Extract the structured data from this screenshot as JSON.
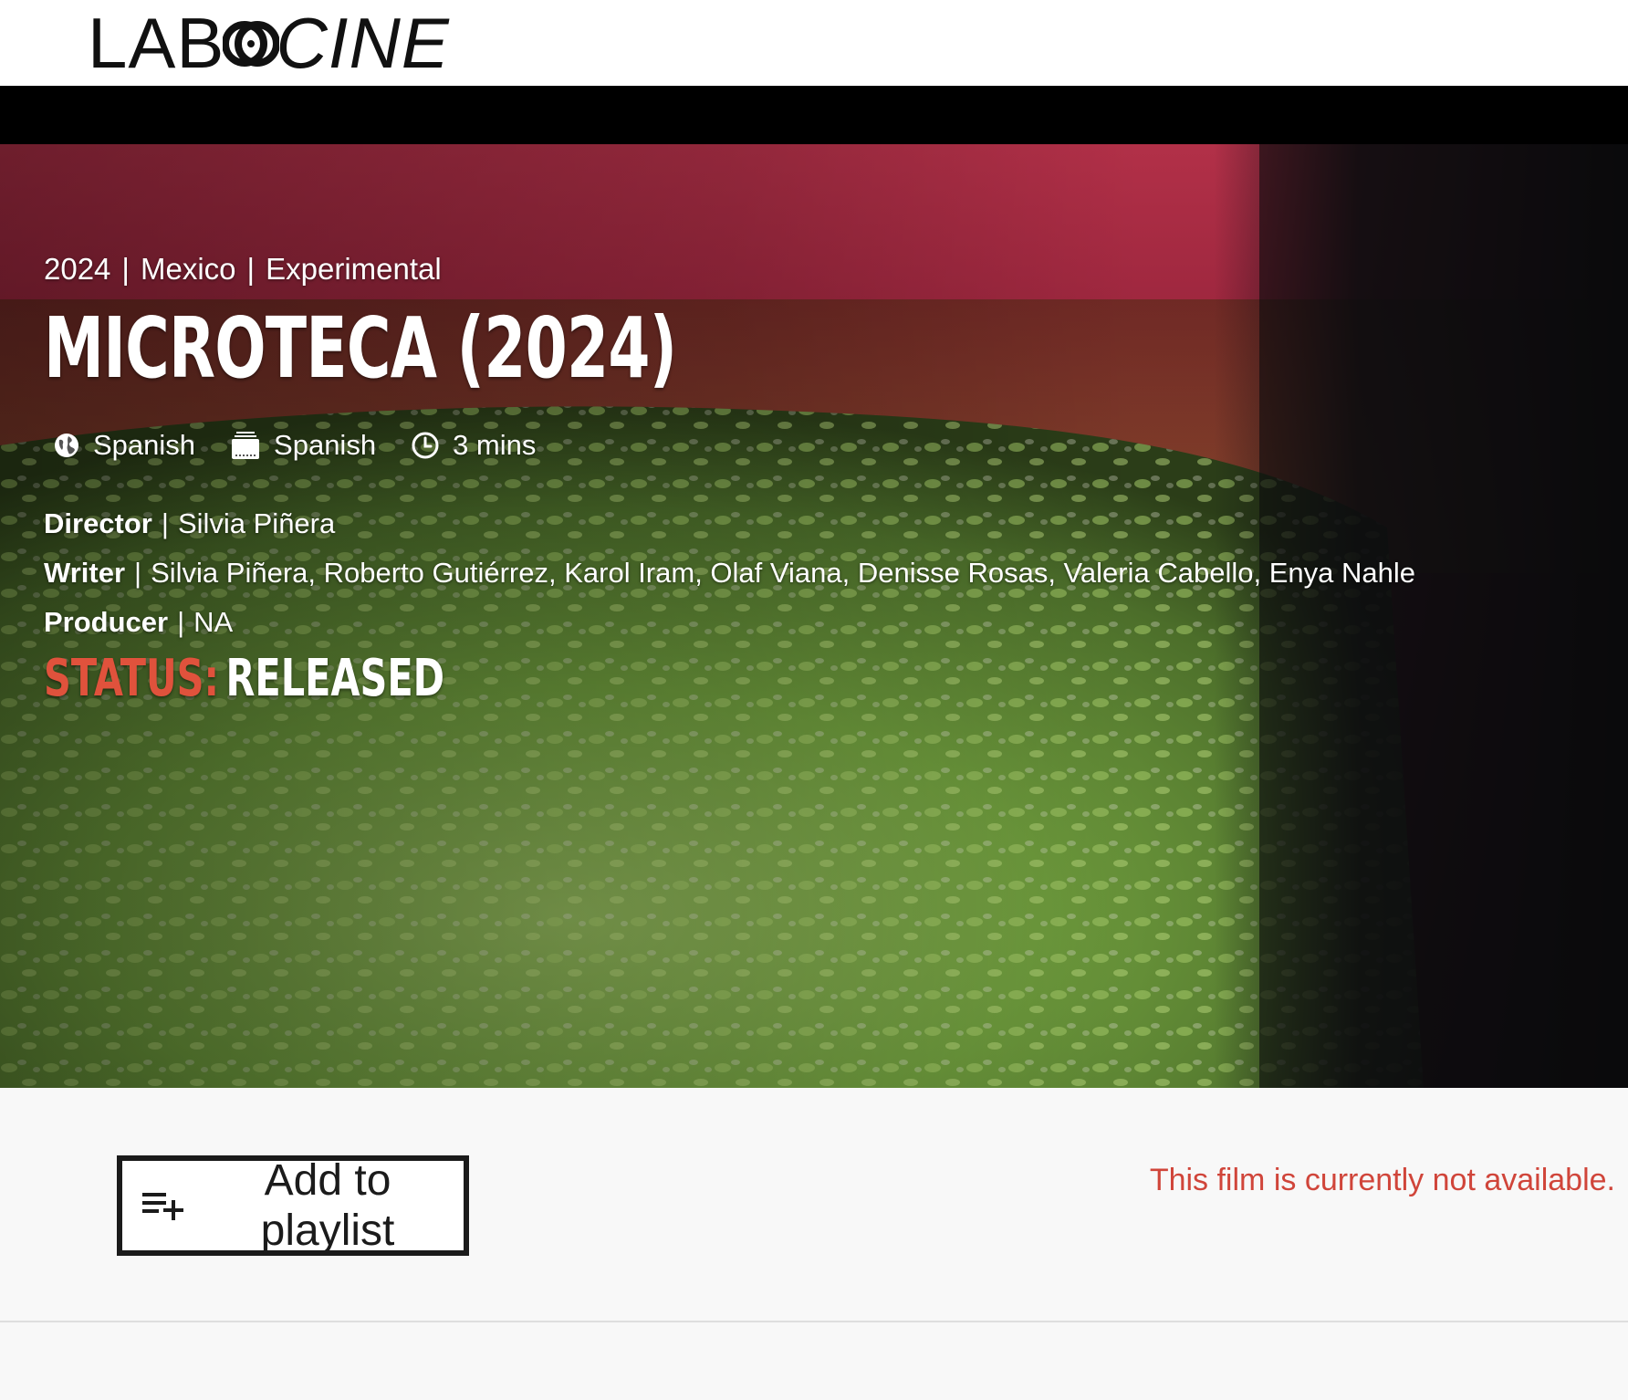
{
  "brand": {
    "logo_left": "LAB",
    "logo_right": "CINE",
    "reel_icon": "film-reel-icon"
  },
  "film": {
    "year": "2024",
    "country": "Mexico",
    "genre": "Experimental",
    "meta_separator": "|",
    "title": "MICROTECA (2024)",
    "language": "Spanish",
    "subtitles": "Spanish",
    "duration": "3 mins",
    "icons": {
      "language": "globe-icon",
      "subtitles": "subtitles-icon",
      "duration": "clock-icon"
    },
    "credits": {
      "director_label": "Director",
      "director": "Silvia Piñera",
      "writer_label": "Writer",
      "writer": "Silvia Piñera, Roberto Gutiérrez, Karol Iram, Olaf Viana, Denisse Rosas, Valeria Cabello, Enya Nahle",
      "producer_label": "Producer",
      "producer": "NA",
      "separator": "|"
    },
    "status_label": "STATUS:",
    "status": "RELEASED"
  },
  "actions": {
    "playlist_label": "Add to playlist",
    "playlist_icon": "playlist-add-icon",
    "availability_note": "This film is currently not available."
  },
  "colors": {
    "status_accent": "#e0523c",
    "availability_text": "#d0453a",
    "button_border": "#1b1b1b",
    "strip": "#000000"
  }
}
